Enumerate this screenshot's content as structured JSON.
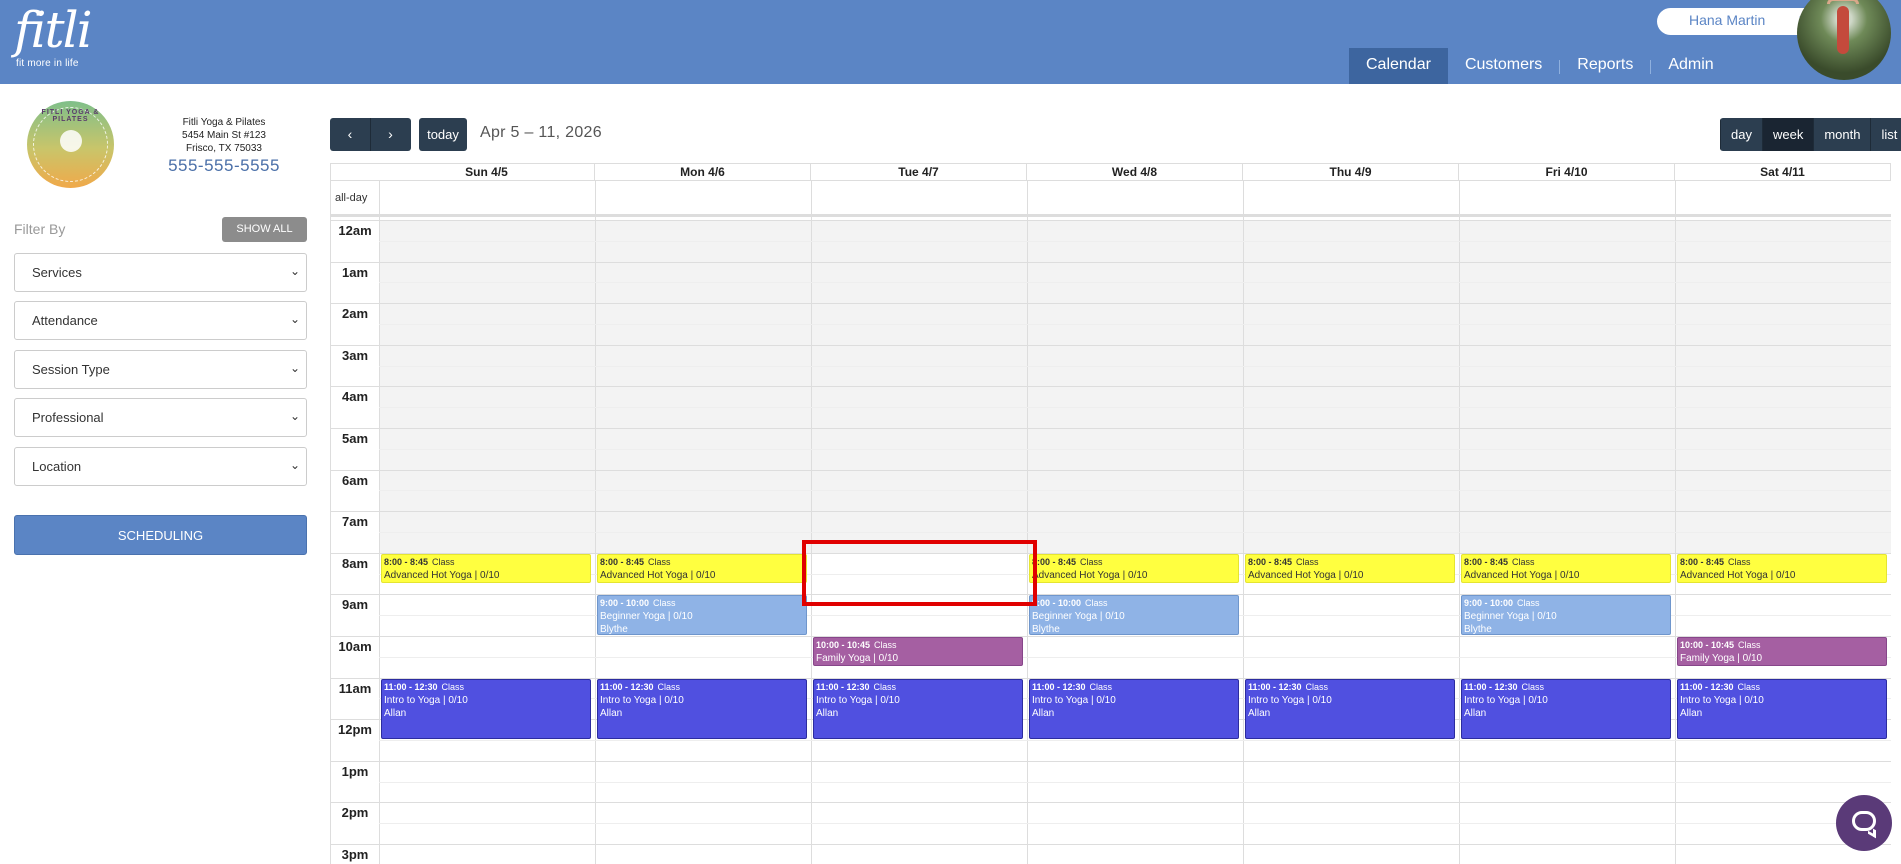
{
  "header": {
    "logo_word": "fitli",
    "logo_tagline": "fit more in life",
    "user_name": "Hana Martin",
    "user_chevron": "»",
    "nav": [
      {
        "label": "Calendar",
        "active": true
      },
      {
        "label": "Customers",
        "active": false
      },
      {
        "label": "Reports",
        "active": false
      },
      {
        "label": "Admin",
        "active": false
      }
    ]
  },
  "studio": {
    "logo_text": "FITLI YOGA & PILATES",
    "name": "Fitli Yoga & Pilates",
    "address1": "5454 Main St #123",
    "address2": "Frisco, TX 75033",
    "phone": "555-555-5555"
  },
  "filters": {
    "label": "Filter By",
    "show_all": "SHOW ALL",
    "selects": [
      "Services",
      "Attendance",
      "Session Type",
      "Professional",
      "Location"
    ],
    "scheduling": "SCHEDULING"
  },
  "toolbar": {
    "prev": "‹",
    "next": "›",
    "today": "today",
    "range": "Apr 5 – 11, 2026",
    "views": [
      {
        "label": "day",
        "active": false
      },
      {
        "label": "week",
        "active": true
      },
      {
        "label": "month",
        "active": false
      },
      {
        "label": "list",
        "active": false
      }
    ]
  },
  "calendar": {
    "allday_label": "all-day",
    "days": [
      "Sun 4/5",
      "Mon 4/6",
      "Tue 4/7",
      "Wed 4/8",
      "Thu 4/9",
      "Fri 4/10",
      "Sat 4/11"
    ],
    "hours": [
      "12am",
      "1am",
      "2am",
      "3am",
      "4am",
      "5am",
      "6am",
      "7am",
      "8am",
      "9am",
      "10am",
      "11am",
      "12pm",
      "1pm",
      "2pm",
      "3pm"
    ],
    "events": [
      {
        "day": 0,
        "start": 8,
        "end": 8.75,
        "time": "8:00 - 8:45",
        "kind": "Class",
        "title": "Advanced Hot Yoga | 0/10",
        "instructor": "",
        "color": "yellow"
      },
      {
        "day": 1,
        "start": 8,
        "end": 8.75,
        "time": "8:00 - 8:45",
        "kind": "Class",
        "title": "Advanced Hot Yoga | 0/10",
        "instructor": "",
        "color": "yellow"
      },
      {
        "day": 3,
        "start": 8,
        "end": 8.75,
        "time": "8:00 - 8:45",
        "kind": "Class",
        "title": "Advanced Hot Yoga | 0/10",
        "instructor": "",
        "color": "yellow"
      },
      {
        "day": 4,
        "start": 8,
        "end": 8.75,
        "time": "8:00 - 8:45",
        "kind": "Class",
        "title": "Advanced Hot Yoga | 0/10",
        "instructor": "",
        "color": "yellow"
      },
      {
        "day": 5,
        "start": 8,
        "end": 8.75,
        "time": "8:00 - 8:45",
        "kind": "Class",
        "title": "Advanced Hot Yoga | 0/10",
        "instructor": "",
        "color": "yellow"
      },
      {
        "day": 6,
        "start": 8,
        "end": 8.75,
        "time": "8:00 - 8:45",
        "kind": "Class",
        "title": "Advanced Hot Yoga | 0/10",
        "instructor": "",
        "color": "yellow"
      },
      {
        "day": 1,
        "start": 9,
        "end": 10,
        "time": "9:00 - 10:00",
        "kind": "Class",
        "title": "Beginner Yoga | 0/10",
        "instructor": "Blythe",
        "color": "lblue"
      },
      {
        "day": 3,
        "start": 9,
        "end": 10,
        "time": "9:00 - 10:00",
        "kind": "Class",
        "title": "Beginner Yoga | 0/10",
        "instructor": "Blythe",
        "color": "lblue"
      },
      {
        "day": 5,
        "start": 9,
        "end": 10,
        "time": "9:00 - 10:00",
        "kind": "Class",
        "title": "Beginner Yoga | 0/10",
        "instructor": "Blythe",
        "color": "lblue"
      },
      {
        "day": 2,
        "start": 10,
        "end": 10.75,
        "time": "10:00 - 10:45",
        "kind": "Class",
        "title": "Family Yoga | 0/10",
        "instructor": "",
        "color": "purple"
      },
      {
        "day": 6,
        "start": 10,
        "end": 10.75,
        "time": "10:00 - 10:45",
        "kind": "Class",
        "title": "Family Yoga | 0/10",
        "instructor": "",
        "color": "purple"
      },
      {
        "day": 0,
        "start": 11,
        "end": 12.5,
        "time": "11:00 - 12:30",
        "kind": "Class",
        "title": "Intro to Yoga | 0/10",
        "instructor": "Allan",
        "color": "blue"
      },
      {
        "day": 1,
        "start": 11,
        "end": 12.5,
        "time": "11:00 - 12:30",
        "kind": "Class",
        "title": "Intro to Yoga | 0/10",
        "instructor": "Allan",
        "color": "blue"
      },
      {
        "day": 2,
        "start": 11,
        "end": 12.5,
        "time": "11:00 - 12:30",
        "kind": "Class",
        "title": "Intro to Yoga | 0/10",
        "instructor": "Allan",
        "color": "blue"
      },
      {
        "day": 3,
        "start": 11,
        "end": 12.5,
        "time": "11:00 - 12:30",
        "kind": "Class",
        "title": "Intro to Yoga | 0/10",
        "instructor": "Allan",
        "color": "blue"
      },
      {
        "day": 4,
        "start": 11,
        "end": 12.5,
        "time": "11:00 - 12:30",
        "kind": "Class",
        "title": "Intro to Yoga | 0/10",
        "instructor": "Allan",
        "color": "blue"
      },
      {
        "day": 5,
        "start": 11,
        "end": 12.5,
        "time": "11:00 - 12:30",
        "kind": "Class",
        "title": "Intro to Yoga | 0/10",
        "instructor": "Allan",
        "color": "blue"
      },
      {
        "day": 6,
        "start": 11,
        "end": 12.5,
        "time": "11:00 - 12:30",
        "kind": "Class",
        "title": "Intro to Yoga | 0/10",
        "instructor": "Allan",
        "color": "blue"
      }
    ]
  },
  "colors": {
    "header": "#5b85c5",
    "nav_active": "#3d659f",
    "toolbar": "#2c3e50",
    "highlight": "#e00000",
    "chat": "#5a3a78"
  },
  "icons": {
    "chat": "chat-bubble-icon",
    "select_arrow": "chevron-down-icon"
  }
}
